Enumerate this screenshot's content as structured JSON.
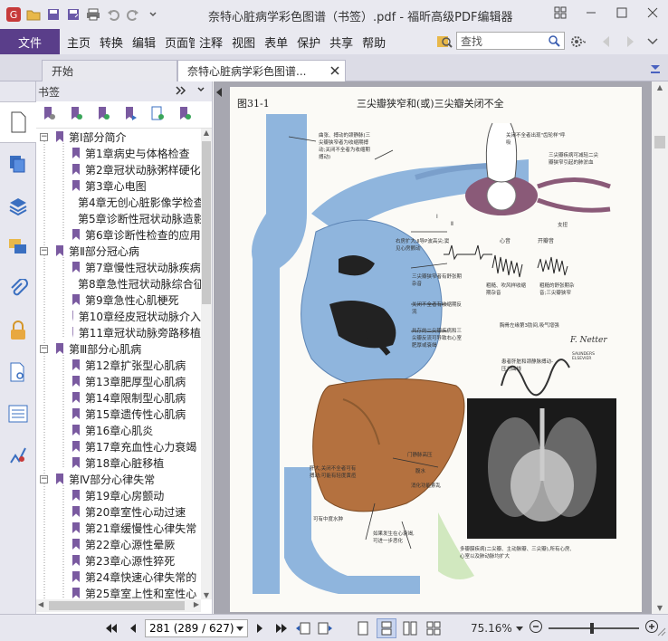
{
  "window": {
    "title": "奈特心脏病学彩色图谱（书签）.pdf - 福昕高级PDF编辑器"
  },
  "menu": {
    "file": "文件",
    "items": [
      "主页",
      "转换",
      "编辑",
      "页面管理",
      "注释",
      "视图",
      "表单",
      "保护",
      "共享",
      "帮助"
    ]
  },
  "search": {
    "placeholder": "查找"
  },
  "tabs": [
    {
      "label": "开始"
    },
    {
      "label": "奈特心脏病学彩色图谱..."
    }
  ],
  "bookmarks": {
    "header": "书签",
    "items": [
      {
        "label": "第Ⅰ部分简介",
        "level": 0
      },
      {
        "label": "第1章病史与体格检查",
        "level": 1
      },
      {
        "label": "第2章冠状动脉粥样硬化",
        "level": 1
      },
      {
        "label": "第3章心电图",
        "level": 1
      },
      {
        "label": "第4章无创心脏影像学检查",
        "level": 1
      },
      {
        "label": "第5章诊断性冠状动脉造影",
        "level": 1
      },
      {
        "label": "第6章诊断性检查的应用",
        "level": 1
      },
      {
        "label": "第Ⅱ部分冠心病",
        "level": 0
      },
      {
        "label": "第7章慢性冠状动脉疾病",
        "level": 1
      },
      {
        "label": "第8章急性冠状动脉综合征",
        "level": 1
      },
      {
        "label": "第9章急性心肌梗死",
        "level": 1
      },
      {
        "label": "第10章经皮冠状动脉介入",
        "level": 1
      },
      {
        "label": "第11章冠状动脉旁路移植",
        "level": 1
      },
      {
        "label": "第Ⅲ部分心肌病",
        "level": 0
      },
      {
        "label": "第12章扩张型心肌病",
        "level": 1
      },
      {
        "label": "第13章肥厚型心肌病",
        "level": 1
      },
      {
        "label": "第14章限制型心肌病",
        "level": 1
      },
      {
        "label": "第15章遗传性心肌病",
        "level": 1
      },
      {
        "label": "第16章心肌炎",
        "level": 1
      },
      {
        "label": "第17章充血性心力衰竭",
        "level": 1
      },
      {
        "label": "第18章心脏移植",
        "level": 1
      },
      {
        "label": "第Ⅳ部分心律失常",
        "level": 0
      },
      {
        "label": "第19章心房颤动",
        "level": 1
      },
      {
        "label": "第20章室性心动过速",
        "level": 1
      },
      {
        "label": "第21章缓慢性心律失常",
        "level": 1
      },
      {
        "label": "第22章心源性晕厥",
        "level": 1
      },
      {
        "label": "第23章心源性猝死",
        "level": 1
      },
      {
        "label": "第24章快速心律失常的",
        "level": 1
      },
      {
        "label": "第25章室上性和室性心",
        "level": 1
      }
    ]
  },
  "document": {
    "figure_id": "图31-1",
    "figure_title": "三尖瓣狭窄和(或)三尖瓣关闭不全",
    "annotations": {
      "a1": "曲张、搏动的颈静脉(三尖瓣狭窄者为收缩期搏动;关闭不全者为收缩期搏动)",
      "a2": "关闭不全者出现\"齿轮样\"呼吸",
      "a3": "三尖瓣疾病可减轻二尖瓣狭窄引起的肺淤血",
      "a4": "支扭",
      "a5": "右房扩大;Ⅱ导P波高尖;窦见心房颤动",
      "a6": "三尖瓣狭窄者有舒张期杂音",
      "a7": "关闭不全者有收缩期反流",
      "a8": "共存的二尖瓣疾病和三尖瓣反流可导致右心室肥厚或衰竭",
      "a9": "粗糙、吹风样收缩期杂音",
      "a10": "粗糙的舒张期杂音;三尖瓣狭窄",
      "a11": "胸骨左缘第3肋间,吸气增强",
      "a12": "患者肝脏和颈静脉搏动-压力曲线",
      "a13": "门静脉高压",
      "a14": "腹水",
      "a15": "消化功能紊乱",
      "a16": "肝大,关闭不全者可有搏动;可能有轻度黄疸",
      "a17": "可有中度水肿",
      "a18": "如果发生在心衰竭,可进一步恶化",
      "a19": "多瓣膜疾病(二尖瓣、主动脉瓣、三尖瓣),所有心房,心室以及肺动脉均扩大",
      "ecg1": "Ⅰ",
      "ecg2": "Ⅱ",
      "heart_sound1": "心音",
      "heart_sound2": "开瓣音",
      "signature": "F. Netter",
      "publisher": "SAUNDERS ELSEVIER"
    }
  },
  "status": {
    "page_display": "281 (289 / 627)",
    "zoom": "75.16%"
  },
  "colors": {
    "accent": "#5a3e8a",
    "vessel": "#8fb5dd",
    "liver": "#b4713f"
  }
}
